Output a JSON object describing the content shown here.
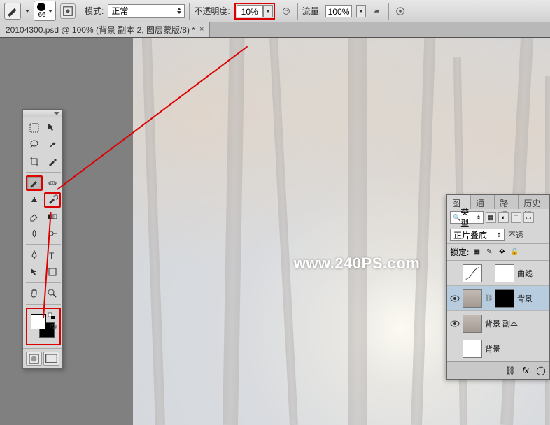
{
  "options_bar": {
    "brush_size": "66",
    "mode_label": "模式:",
    "mode_value": "正常",
    "opacity_label": "不透明度:",
    "opacity_value": "10%",
    "flow_label": "流量:",
    "flow_value": "100%"
  },
  "document_tab": {
    "title": "20104300.psd @ 100% (背景 副本 2, 图层蒙版/8) *"
  },
  "watermark": "www.240PS.com",
  "layers_panel": {
    "tabs": [
      "图层",
      "通道",
      "路径",
      "历史记"
    ],
    "filter_kind": "类型",
    "blend_mode": "正片叠底",
    "opacity_label": "不透",
    "lock_label": "锁定:",
    "layers": [
      {
        "name": "曲线",
        "visible": false,
        "mask": true,
        "thumb": "white"
      },
      {
        "name": "背景",
        "visible": true,
        "mask": true,
        "thumb": "image",
        "selected": true
      },
      {
        "name": "背景 副本",
        "visible": true,
        "mask": false,
        "thumb": "image"
      },
      {
        "name": "背景",
        "visible": false,
        "mask": false,
        "thumb": "white"
      }
    ],
    "footer_fx": "fx"
  },
  "tools": {
    "list": [
      "move",
      "marquee",
      "lasso",
      "wand",
      "crop",
      "eyedropper",
      "brush",
      "healing",
      "stamp",
      "eraser",
      "history-brush",
      "gradient",
      "blur",
      "dodge",
      "pen",
      "type",
      "path-select",
      "shape",
      "hand",
      "zoom"
    ]
  },
  "colors": {
    "foreground": "#ffffff",
    "background": "#000000"
  }
}
